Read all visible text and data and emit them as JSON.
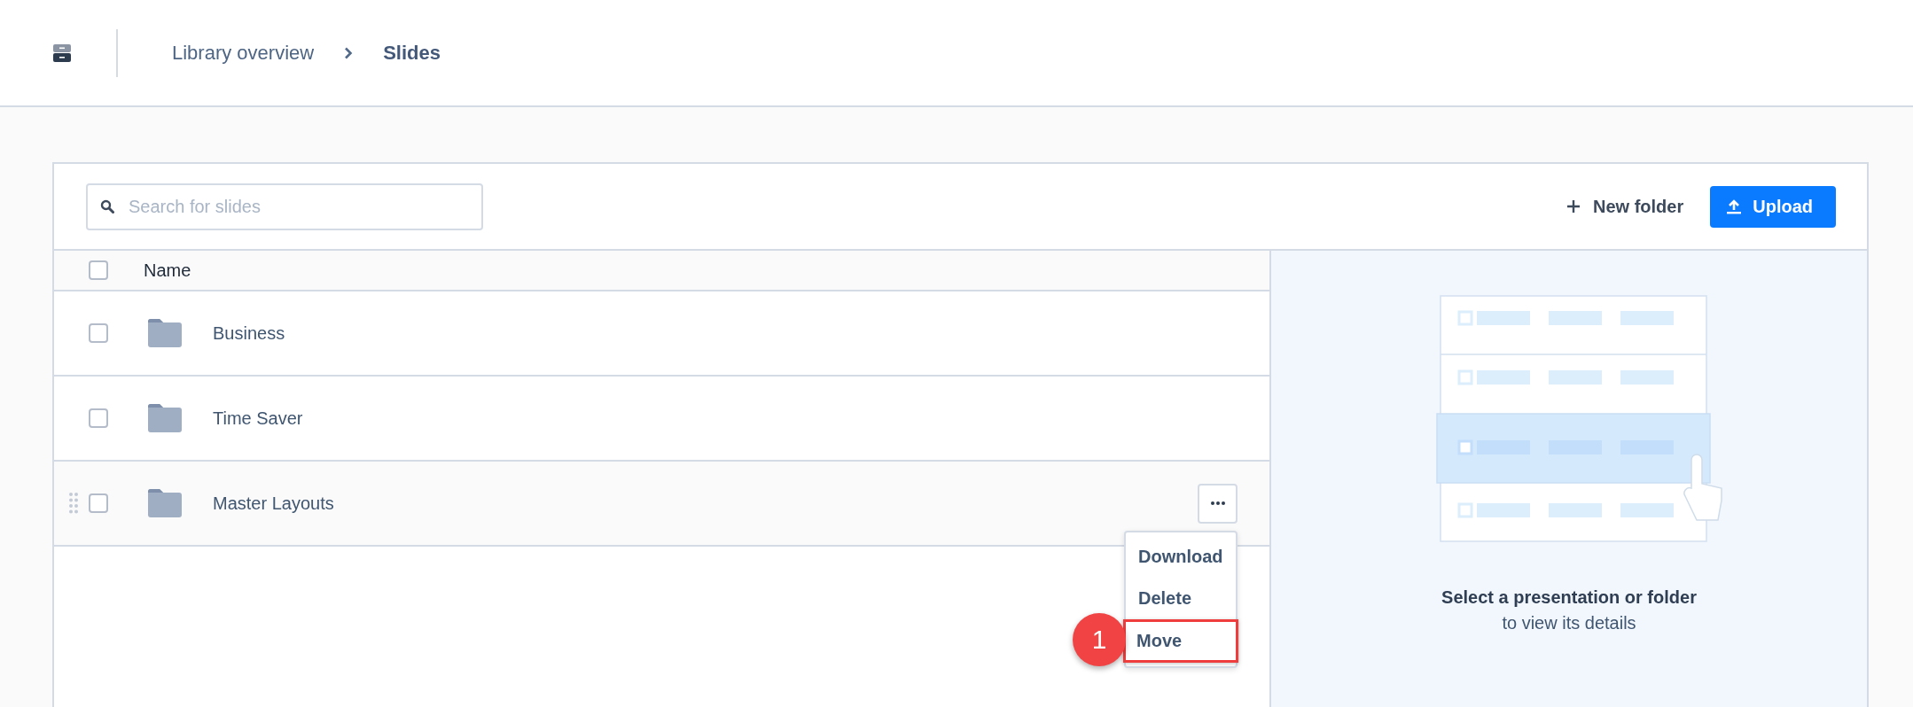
{
  "breadcrumb": [
    {
      "label": "Library overview",
      "current": false
    },
    {
      "label": "Slides",
      "current": true
    }
  ],
  "search": {
    "placeholder": "Search for slides"
  },
  "actions": {
    "new_folder": "New folder",
    "upload": "Upload"
  },
  "table": {
    "columns": [
      "Name"
    ],
    "all_checked": false,
    "rows": [
      {
        "name": "Business",
        "checked": false,
        "hovered": false
      },
      {
        "name": "Time Saver",
        "checked": false,
        "hovered": false
      },
      {
        "name": "Master Layouts",
        "checked": false,
        "hovered": true
      }
    ]
  },
  "context_menu": {
    "items": [
      {
        "label": "Download",
        "highlighted": false
      },
      {
        "label": "Delete",
        "highlighted": false
      },
      {
        "label": "Move",
        "highlighted": true
      }
    ]
  },
  "callout": {
    "label": "1"
  },
  "details_panel": {
    "title": "Select a presentation or folder",
    "subtitle": "to view its details"
  }
}
